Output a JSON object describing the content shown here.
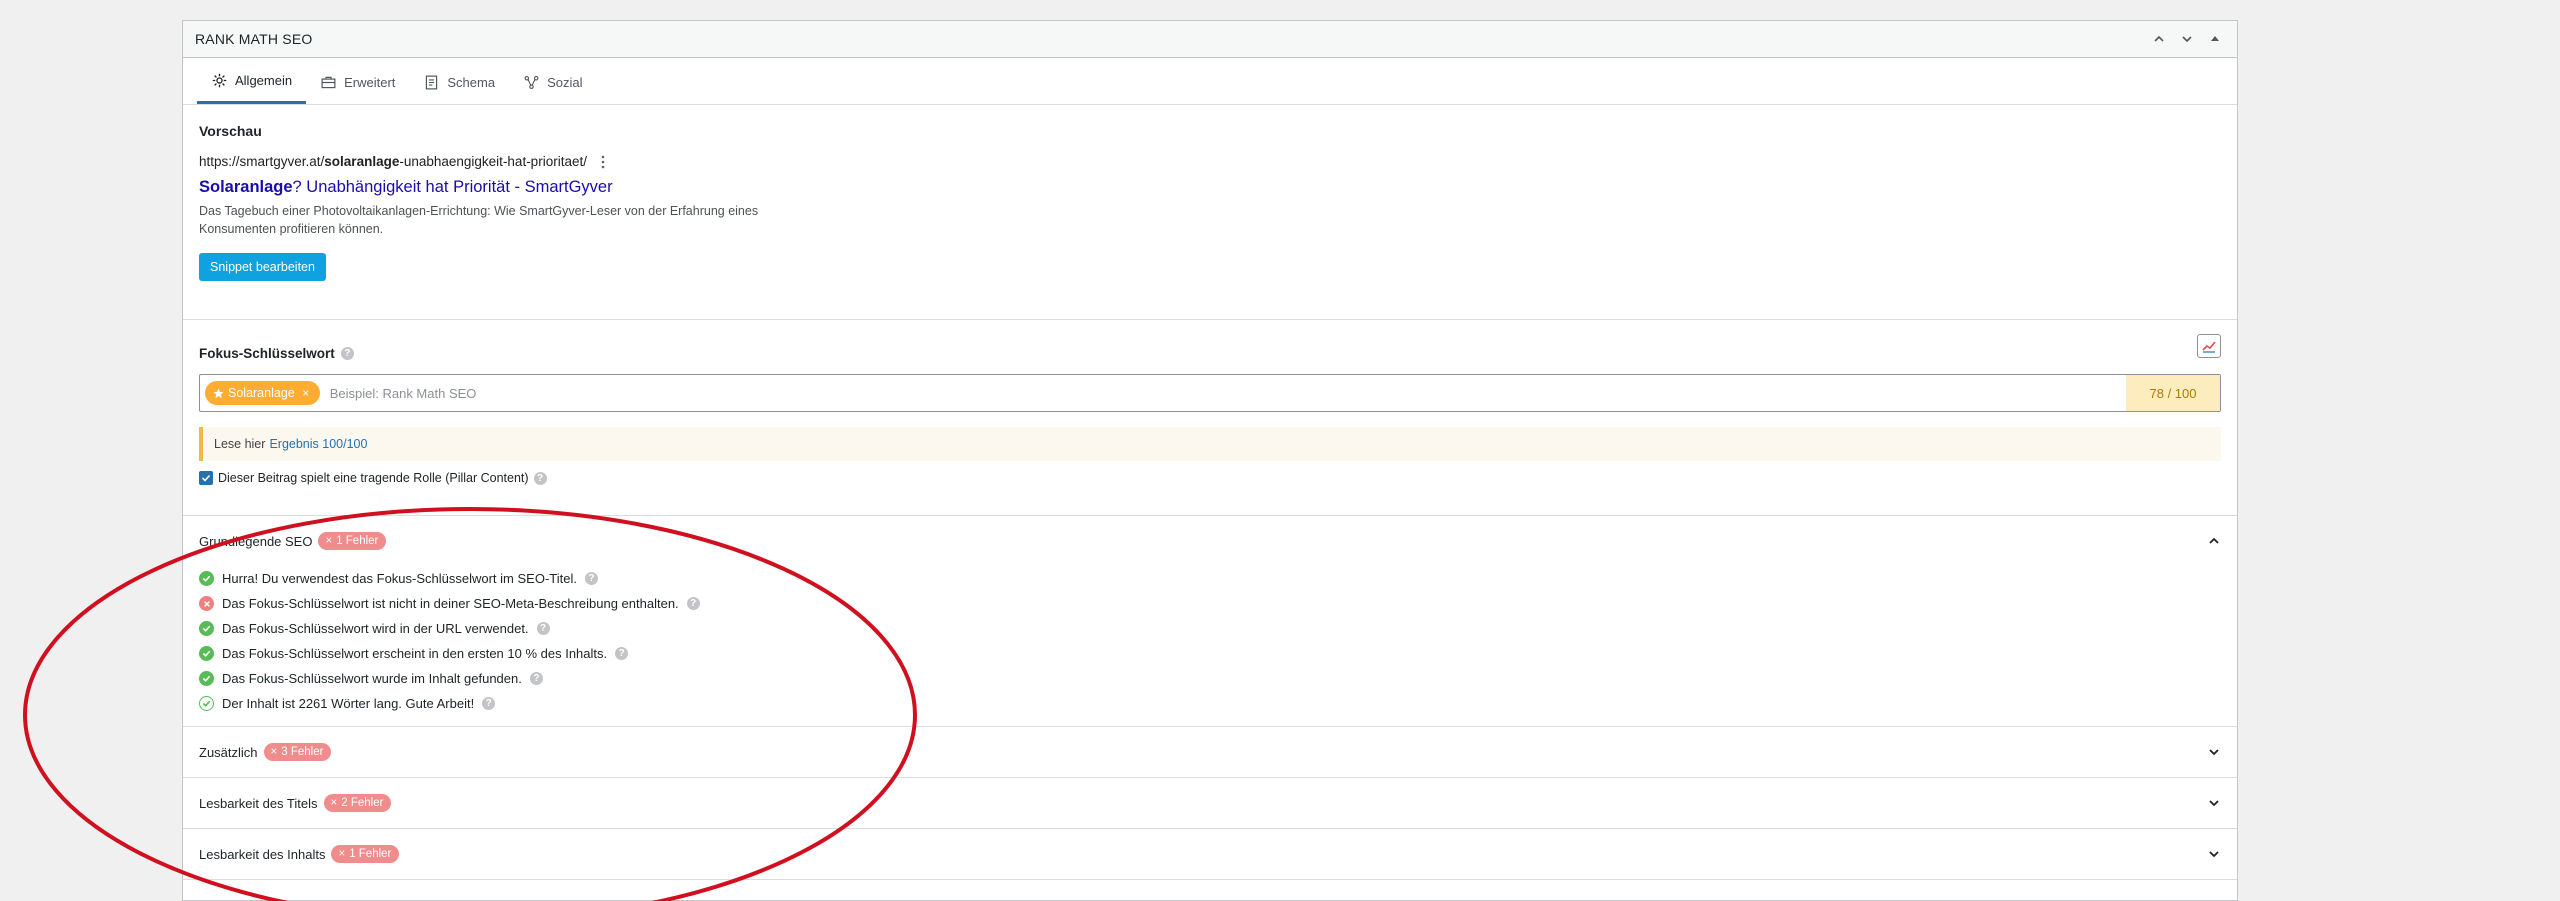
{
  "metabox": {
    "title": "RANK MATH SEO"
  },
  "tabs": [
    {
      "label": "Allgemein",
      "icon": "gear-icon",
      "active": true
    },
    {
      "label": "Erweitert",
      "icon": "toolbox-icon",
      "active": false
    },
    {
      "label": "Schema",
      "icon": "document-icon",
      "active": false
    },
    {
      "label": "Sozial",
      "icon": "share-icon",
      "active": false
    }
  ],
  "preview": {
    "label": "Vorschau",
    "url_prefix": "https://smartgyver.at/",
    "url_keyword": "solaranlage",
    "url_suffix": "-unabhaengigkeit-hat-prioritaet/",
    "title_keyword": "Solaranlage",
    "title_rest": "? Unabhängigkeit hat Priorität - SmartGyver",
    "description_line1": "Das Tagebuch einer Photovoltaikanlagen-Errichtung: Wie SmartGyver-Leser von der Erfahrung eines",
    "description_line2": "Konsumenten profitieren können.",
    "edit_button": "Snippet bearbeiten"
  },
  "keyword": {
    "label": "Fokus-Schlüsselwort",
    "tag": "Solaranlage",
    "placeholder": "Beispiel: Rank Math SEO",
    "score": "78 / 100",
    "notice_prefix": "Lese hier",
    "notice_link": "Ergebnis 100/100",
    "pillar_label": "Dieser Beitrag spielt eine tragende Rolle (Pillar Content)",
    "pillar_checked": true
  },
  "groups": [
    {
      "title": "Grundlegende SEO",
      "badge": "1 Fehler",
      "expanded": true,
      "checks": [
        {
          "text": "Hurra! Du verwendest das Fokus-Schlüsselwort im SEO-Titel.",
          "status": "ok"
        },
        {
          "text": "Das Fokus-Schlüsselwort ist nicht in deiner SEO-Meta-Beschreibung enthalten.",
          "status": "fail"
        },
        {
          "text": "Das Fokus-Schlüsselwort wird in der URL verwendet.",
          "status": "ok"
        },
        {
          "text": "Das Fokus-Schlüsselwort erscheint in den ersten 10 % des Inhalts.",
          "status": "ok"
        },
        {
          "text": "Das Fokus-Schlüsselwort wurde im Inhalt gefunden.",
          "status": "ok"
        },
        {
          "text": "Der Inhalt ist 2261 Wörter lang. Gute Arbeit!",
          "status": "ok-outline"
        }
      ]
    },
    {
      "title": "Zusätzlich",
      "badge": "3 Fehler",
      "expanded": false
    },
    {
      "title": "Lesbarkeit des Titels",
      "badge": "2 Fehler",
      "expanded": false
    },
    {
      "title": "Lesbarkeit des Inhalts",
      "badge": "1 Fehler",
      "expanded": false
    }
  ],
  "colors": {
    "accent": "#2271b1",
    "button": "#10a1e0",
    "tag": "#ffac32",
    "error_badge": "#f08c8c",
    "ok": "#58bb58",
    "fail": "#f08080",
    "annotation": "#d0101e"
  }
}
